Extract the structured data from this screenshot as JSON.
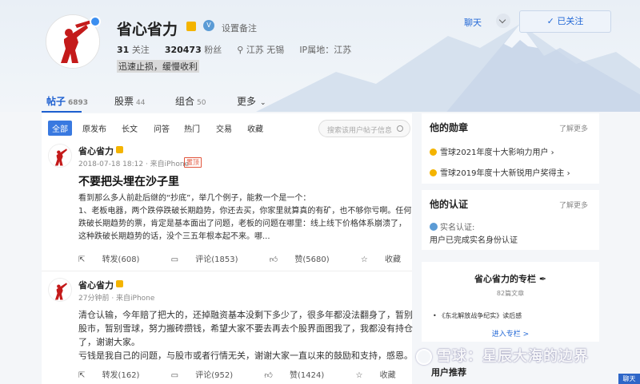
{
  "profile": {
    "username": "省心省力",
    "note": "设置备注",
    "following_count": "31",
    "following_label": "关注",
    "followers_count": "320473",
    "followers_label": "粉丝",
    "location": "江苏 无锡",
    "ip_location": "IP属地：江苏",
    "bio": "迅速止损，缓慢收利",
    "chat_label": "聊天",
    "followed_label": "已关注"
  },
  "tabs": [
    {
      "label": "帖子",
      "count": "6893"
    },
    {
      "label": "股票",
      "count": "44"
    },
    {
      "label": "组合",
      "count": "50"
    },
    {
      "label": "更多",
      "count": ""
    }
  ],
  "filters": [
    "全部",
    "原发布",
    "长文",
    "问答",
    "热门",
    "交易",
    "收藏"
  ],
  "search": {
    "placeholder": "搜索该用户帖子信息"
  },
  "posts": [
    {
      "author": "省心省力",
      "meta": "2018-07-18 18:12 · 来自iPhone",
      "pin": "置顶",
      "title": "不要把头埋在沙子里",
      "lines": [
        "看到那么多人前赴后继的“抄底”，举几个例子，能救一个是一个：",
        "1、老板电器，两个跌停跌破长期趋势，你还去买，你家里就算真的有矿，也不够你亏啊。任何",
        "跌破长期趋势的票，肯定是基本面出了问题，老板的问题在哪里：线上线下价格体系崩溃了，",
        "这种跌破长期趋势的话，没个三五年根本起不来。哪..."
      ],
      "repost": "转发(608)",
      "comment": "评论(1853)",
      "like": "赞(5680)",
      "fav": "收藏"
    },
    {
      "author": "省心省力",
      "meta": "27分钟前 · 来自iPhone",
      "lines": [
        "清仓认输，今年赔了把大的，还掉融资基本没剩下多少了，很多年都没法翻身了，暂别",
        "股市，暂别雪球，努力搬砖攒钱，希望大家不要去再去个股界面图我了，我都没有持仓",
        "了，谢谢大家。",
        "亏钱是我自己的问题，与股市或者行情无关，谢谢大家一直以来的鼓励和支持，感恩。"
      ],
      "repost": "转发(162)",
      "comment": "评论(952)",
      "like": "赞(1424)",
      "fav": "收藏"
    }
  ],
  "side": {
    "medals_title": "他的勋章",
    "more": "了解更多",
    "medals": [
      "雪球2021年度十大影响力用户",
      "雪球2019年度十大新锐用户奖得主"
    ],
    "auth_title": "他的认证",
    "auth_label": "实名认证:",
    "auth_text": "用户已完成实名身份认证",
    "column_title": "省心省力的专栏",
    "column_sub": "82篇文章",
    "column_item": "《东北解放战争纪实》读后感",
    "column_link": "进入专栏 >",
    "recommend": "用户推荐"
  },
  "watermark": "雪球：星辰大海的边界",
  "chat_float": "聊天",
  "colors": {
    "accent": "#1d5fd0",
    "pin": "#e1543b",
    "medal": "#f4b400"
  }
}
